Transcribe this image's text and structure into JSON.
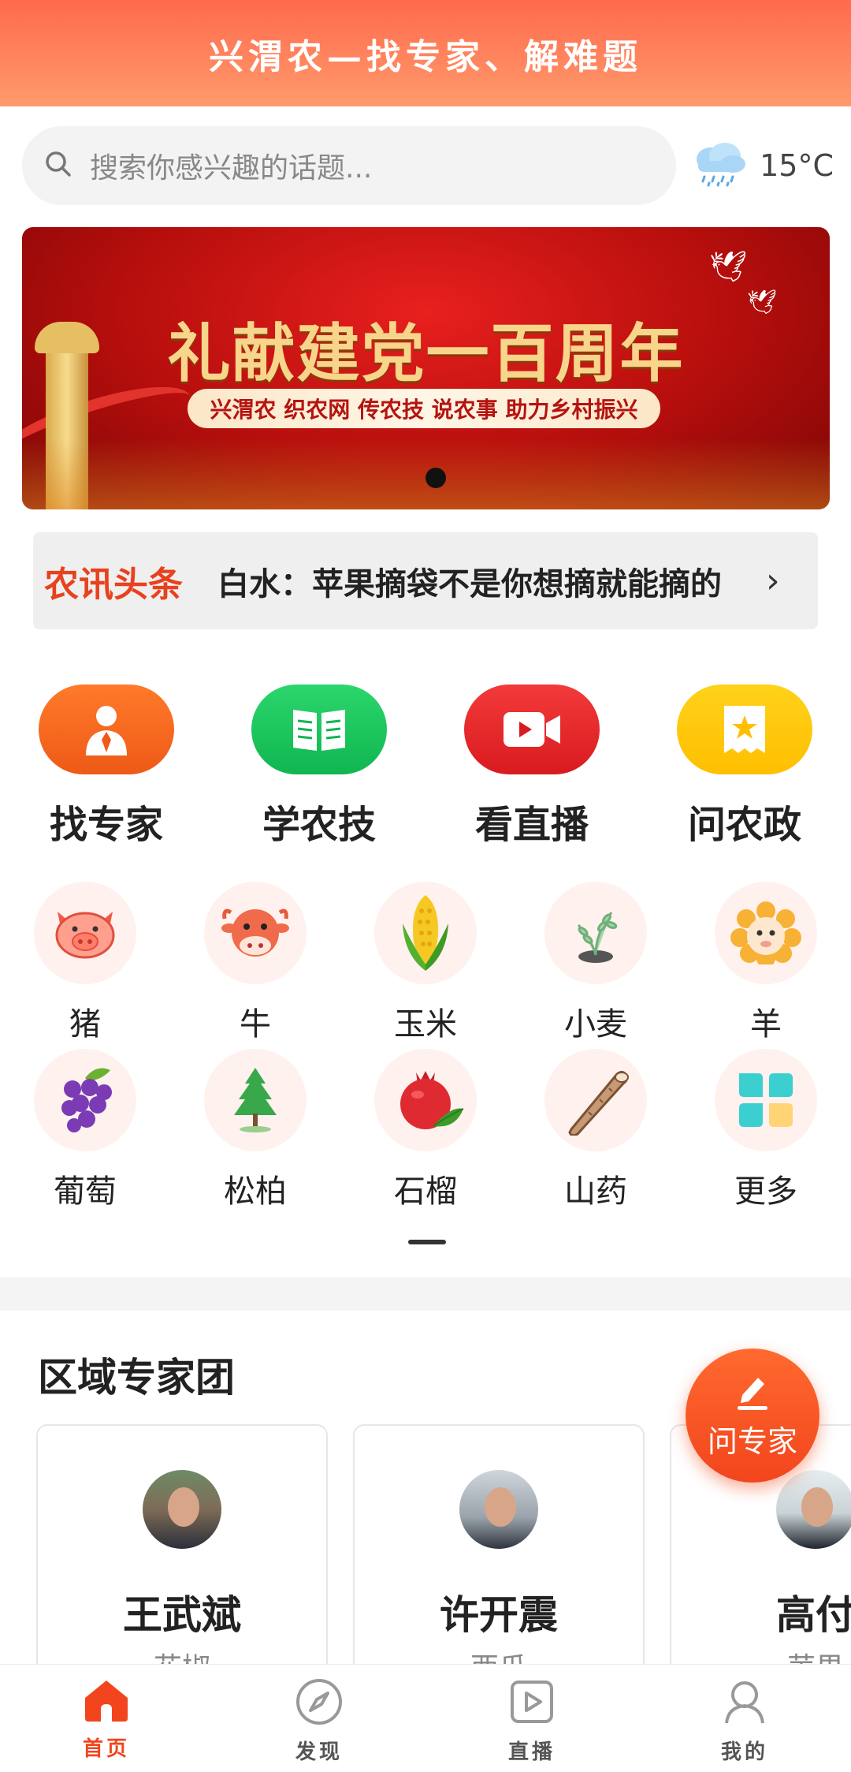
{
  "header": {
    "title": "兴渭农—找专家、解难题"
  },
  "search": {
    "placeholder": "搜索你感兴趣的话题..."
  },
  "weather": {
    "icon": "cloud-rain-icon",
    "temp": "15°C"
  },
  "banner": {
    "title": "礼献建党一百周年",
    "subtitle": "兴渭农 织农网 传农技 说农事 助力乡村振兴",
    "pager": {
      "count": 1,
      "active": 0
    }
  },
  "news": {
    "tag": "农讯头条",
    "headline": "白水：苹果摘袋不是你想摘就能摘的"
  },
  "features": [
    {
      "label": "找专家",
      "icon": "expert-icon",
      "color": "#f26a21"
    },
    {
      "label": "学农技",
      "icon": "book-icon",
      "color": "#16c25a"
    },
    {
      "label": "看直播",
      "icon": "video-icon",
      "color": "#ea2227"
    },
    {
      "label": "问农政",
      "icon": "policy-icon",
      "color": "#ffc400"
    }
  ],
  "categories": [
    {
      "label": "猪",
      "icon": "pig-icon"
    },
    {
      "label": "牛",
      "icon": "cow-icon"
    },
    {
      "label": "玉米",
      "icon": "corn-icon"
    },
    {
      "label": "小麦",
      "icon": "wheat-icon"
    },
    {
      "label": "羊",
      "icon": "sheep-icon"
    },
    {
      "label": "葡萄",
      "icon": "grape-icon"
    },
    {
      "label": "松柏",
      "icon": "pine-icon"
    },
    {
      "label": "石榴",
      "icon": "pomegranate-icon"
    },
    {
      "label": "山药",
      "icon": "yam-icon"
    },
    {
      "label": "更多",
      "icon": "more-icon"
    }
  ],
  "section": {
    "title": "区域专家团"
  },
  "experts": [
    {
      "name": "王武斌",
      "specialty": "花椒"
    },
    {
      "name": "许开震",
      "specialty": "西瓜"
    },
    {
      "name": "高付",
      "specialty": "苹果"
    }
  ],
  "fab": {
    "label": "问专家"
  },
  "tabs": [
    {
      "label": "首页",
      "active": true
    },
    {
      "label": "发现",
      "active": false
    },
    {
      "label": "直播",
      "active": false
    },
    {
      "label": "我的",
      "active": false
    }
  ]
}
